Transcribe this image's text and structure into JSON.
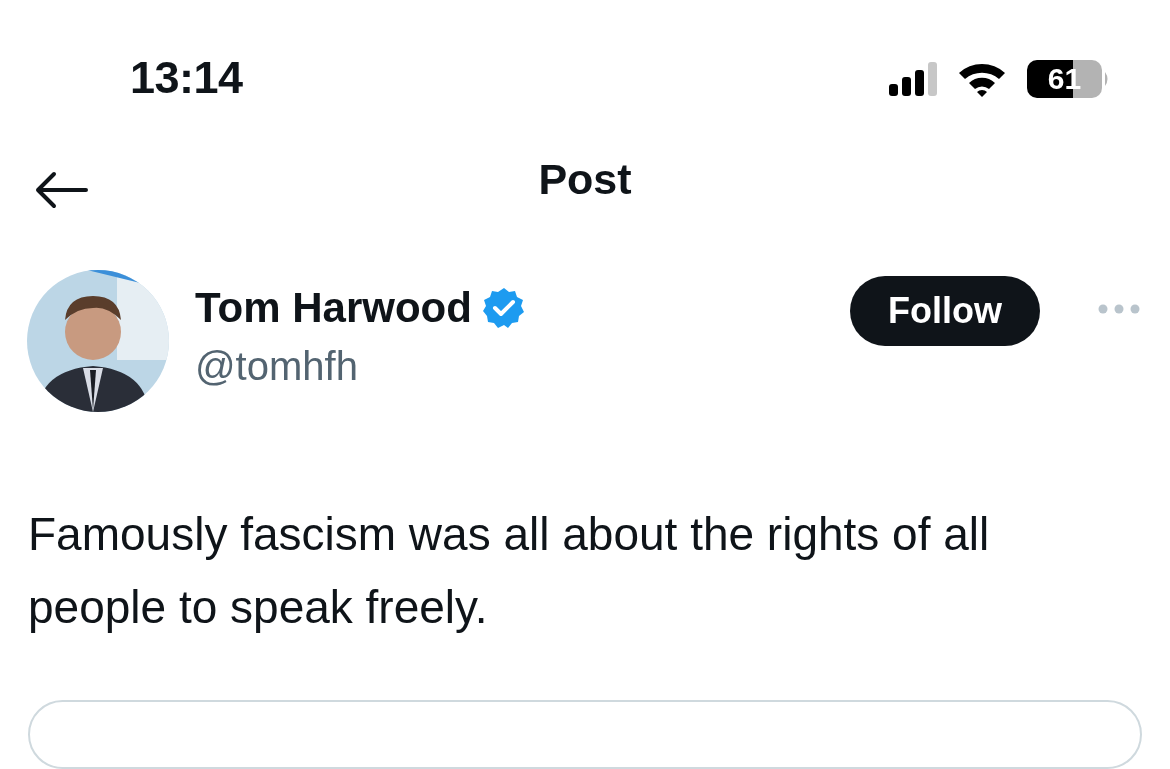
{
  "status_bar": {
    "time": "13:14",
    "battery": "61"
  },
  "header": {
    "title": "Post"
  },
  "post": {
    "author": {
      "name": "Tom Harwood",
      "handle": "@tomhfh",
      "verified": true
    },
    "follow_button": "Follow",
    "text": "Famously fascism was all about the rights of all people to speak freely."
  }
}
